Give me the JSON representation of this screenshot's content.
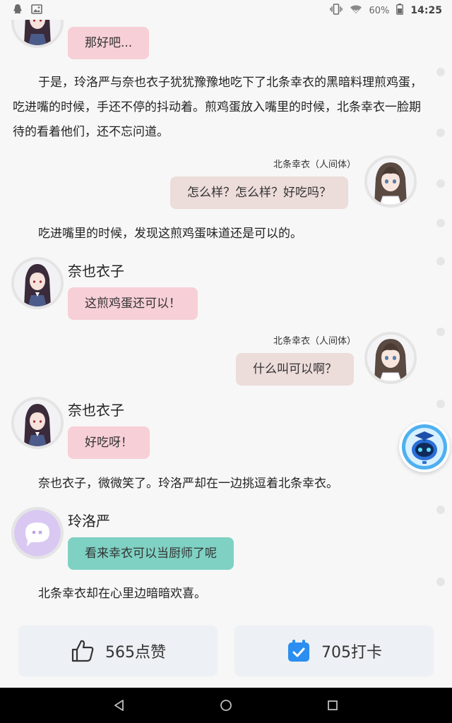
{
  "status_bar": {
    "battery_percent": "60%",
    "time": "14:25"
  },
  "story": {
    "bubble_1": "那好吧...",
    "narration_1": "于是，玲洛严与奈也衣子犹犹豫豫地吃下了北条幸衣的黑暗料理煎鸡蛋，吃进嘴的时候，手还不停的抖动着。煎鸡蛋放入嘴里的时候，北条幸衣一脸期待的看着他们，还不忘问道。",
    "speaker_2": "北条幸衣（人间体）",
    "bubble_2": "怎么样？怎么样？好吃吗？",
    "narration_2": "吃进嘴里的时候，发现这煎鸡蛋味道还是可以的。",
    "speaker_3": "奈也衣子",
    "bubble_3": "这煎鸡蛋还可以！",
    "speaker_4": "北条幸衣（人间体）",
    "bubble_4": "什么叫可以啊？",
    "speaker_5": "奈也衣子",
    "bubble_5": "好吃呀！",
    "narration_3": "奈也衣子，微微笑了。玲洛严却在一边挑逗着北条幸衣。",
    "speaker_6": "玲洛严",
    "bubble_6": "看来幸衣可以当厨师了呢",
    "narration_4": "北条幸衣却在心里边暗暗欢喜。"
  },
  "actions": {
    "like_label": "565点赞",
    "checkin_label": "705打卡"
  },
  "colors": {
    "pink_bubble": "#f7cfd7",
    "beige_bubble": "#ecdcda",
    "teal_bubble": "#7fd1c3",
    "checkin_blue": "#2b8ef0"
  }
}
